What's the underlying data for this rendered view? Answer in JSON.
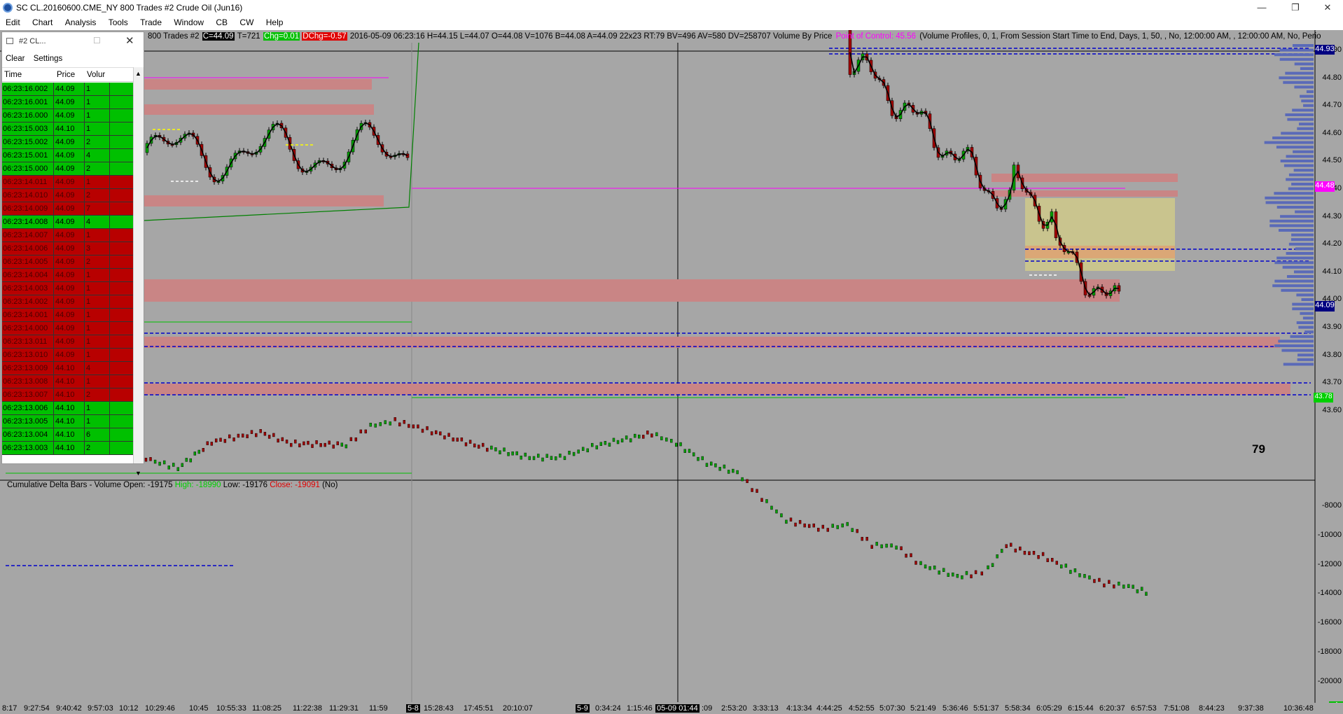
{
  "window": {
    "title": "SC CL.20160600.CME_NY  800 Trades  #2  Crude Oil (Jun16)",
    "controls": [
      "—",
      "❐",
      "✕"
    ]
  },
  "menu": [
    "Edit",
    "Chart",
    "Analysis",
    "Tools",
    "Trade",
    "Window",
    "CB",
    "CW",
    "Help"
  ],
  "infoline": {
    "prefix": "800 Trades  #2",
    "close": "C=44.09",
    "trades": "T=721",
    "chg": "Chg=0.01",
    "dchg": "DChg=-0.57",
    "details": "2016-05-09 06:23:16 H=44.15 L=44.07 O=44.08 V=1076 B=44.08 A=44.09 22x23 RT:79 BV=496 AV=580 DV=258707 Volume By Price",
    "poc": "Point of Control: 45.56",
    "profile": "(Volume Profiles, 0, 1, From Session Start Time to End, Days, 1, 50, , No, 12:00:00 AM, , 12:00:00 AM, No, Perio"
  },
  "price_axis": [
    "44.90",
    "44.80",
    "44.70",
    "44.60",
    "44.50",
    "44.40",
    "44.30",
    "44.20",
    "44.10",
    "44.00",
    "43.90",
    "43.80",
    "43.70",
    "43.60"
  ],
  "price_tags": {
    "top": "44.93",
    "poc": "44.48",
    "current": "44.09",
    "green": "43.78"
  },
  "counter": "79",
  "lower_panel": {
    "label": "Cumulative Delta Bars - Volume  Open: -19175",
    "high": "High: -18990",
    "low": "Low: -19176",
    "close": "Close: -19091",
    "suffix": "(No)",
    "axis": [
      "-8000",
      "-10000",
      "-12000",
      "-14000",
      "-16000",
      "-18000",
      "-20000"
    ],
    "end_tag": "4"
  },
  "time_axis": [
    {
      "t": "8:17"
    },
    {
      "t": "9:27:54"
    },
    {
      "t": "9:40:42"
    },
    {
      "t": "9:57:03"
    },
    {
      "t": "10:12"
    },
    {
      "t": "10:29:46"
    },
    {
      "t": "10:45"
    },
    {
      "t": "10:55:33"
    },
    {
      "t": "11:08:25"
    },
    {
      "t": "11:22:38"
    },
    {
      "t": "11:29:31"
    },
    {
      "t": "11:59"
    },
    {
      "t": "5-8",
      "dark": true
    },
    {
      "t": "15:28:43"
    },
    {
      "t": "17:45:51"
    },
    {
      "t": "20:10:07"
    },
    {
      "t": "5-9",
      "dark": true
    },
    {
      "t": "0:34:24"
    },
    {
      "t": "1:15:46"
    },
    {
      "t": "05-09  01:44",
      "dark": true
    },
    {
      "t": ":09"
    },
    {
      "t": "2:53:20"
    },
    {
      "t": "3:33:13"
    },
    {
      "t": "4:13:34"
    },
    {
      "t": "4:44:25"
    },
    {
      "t": "4:52:55"
    },
    {
      "t": "5:07:30"
    },
    {
      "t": "5:21:49"
    },
    {
      "t": "5:36:46"
    },
    {
      "t": "5:51:37"
    },
    {
      "t": "5:58:34"
    },
    {
      "t": "6:05:29"
    },
    {
      "t": "6:15:44"
    },
    {
      "t": "6:20:37"
    },
    {
      "t": "6:57:53"
    },
    {
      "t": "7:51:08"
    },
    {
      "t": "8:44:23"
    },
    {
      "t": "9:37:38"
    },
    {
      "t": "10:36:48"
    }
  ],
  "time_sales": {
    "title": "#2 CL...",
    "menu": [
      "Clear",
      "Settings"
    ],
    "columns": [
      "Time",
      "Price",
      "Volur"
    ],
    "rows": [
      {
        "time": "06:23:16.002",
        "price": "44.09",
        "vol": "1",
        "side": "buy"
      },
      {
        "time": "06:23:16.001",
        "price": "44.09",
        "vol": "1",
        "side": "buy"
      },
      {
        "time": "06:23:16.000",
        "price": "44.09",
        "vol": "1",
        "side": "buy"
      },
      {
        "time": "06:23:15.003",
        "price": "44.10",
        "vol": "1",
        "side": "buy"
      },
      {
        "time": "06:23:15.002",
        "price": "44.09",
        "vol": "2",
        "side": "buy"
      },
      {
        "time": "06:23:15.001",
        "price": "44.09",
        "vol": "4",
        "side": "buy"
      },
      {
        "time": "06:23:15.000",
        "price": "44.09",
        "vol": "2",
        "side": "buy"
      },
      {
        "time": "06:23:14.011",
        "price": "44.09",
        "vol": "1",
        "side": "sell"
      },
      {
        "time": "06:23:14.010",
        "price": "44.09",
        "vol": "2",
        "side": "sell"
      },
      {
        "time": "06:23:14.009",
        "price": "44.09",
        "vol": "7",
        "side": "sell"
      },
      {
        "time": "06:23:14.008",
        "price": "44.09",
        "vol": "4",
        "side": "buy"
      },
      {
        "time": "06:23:14.007",
        "price": "44.09",
        "vol": "1",
        "side": "sell"
      },
      {
        "time": "06:23:14.006",
        "price": "44.09",
        "vol": "3",
        "side": "sell"
      },
      {
        "time": "06:23:14.005",
        "price": "44.09",
        "vol": "2",
        "side": "sell"
      },
      {
        "time": "06:23:14.004",
        "price": "44.09",
        "vol": "1",
        "side": "sell"
      },
      {
        "time": "06:23:14.003",
        "price": "44.09",
        "vol": "1",
        "side": "sell"
      },
      {
        "time": "06:23:14.002",
        "price": "44.09",
        "vol": "1",
        "side": "sell"
      },
      {
        "time": "06:23:14.001",
        "price": "44.09",
        "vol": "1",
        "side": "sell"
      },
      {
        "time": "06:23:14.000",
        "price": "44.09",
        "vol": "1",
        "side": "sell"
      },
      {
        "time": "06:23:13.011",
        "price": "44.09",
        "vol": "1",
        "side": "sell"
      },
      {
        "time": "06:23:13.010",
        "price": "44.09",
        "vol": "1",
        "side": "sell"
      },
      {
        "time": "06:23:13.009",
        "price": "44.10",
        "vol": "4",
        "side": "sell"
      },
      {
        "time": "06:23:13.008",
        "price": "44.10",
        "vol": "1",
        "side": "sell"
      },
      {
        "time": "06:23:13.007",
        "price": "44.10",
        "vol": "2",
        "side": "sell"
      },
      {
        "time": "06:23:13.006",
        "price": "44.10",
        "vol": "1",
        "side": "buy"
      },
      {
        "time": "06:23:13.005",
        "price": "44.10",
        "vol": "1",
        "side": "buy"
      },
      {
        "time": "06:23:13.004",
        "price": "44.10",
        "vol": "6",
        "side": "buy"
      },
      {
        "time": "06:23:13.003",
        "price": "44.10",
        "vol": "2",
        "side": "buy"
      }
    ]
  },
  "colors": {
    "background": "#a6a6a6",
    "zone": "#c98585",
    "value_area": "#cfc98a",
    "buy": "#00c000",
    "sell": "#b80000",
    "level_line": "#0000cc",
    "poc": "#ff00ff"
  }
}
